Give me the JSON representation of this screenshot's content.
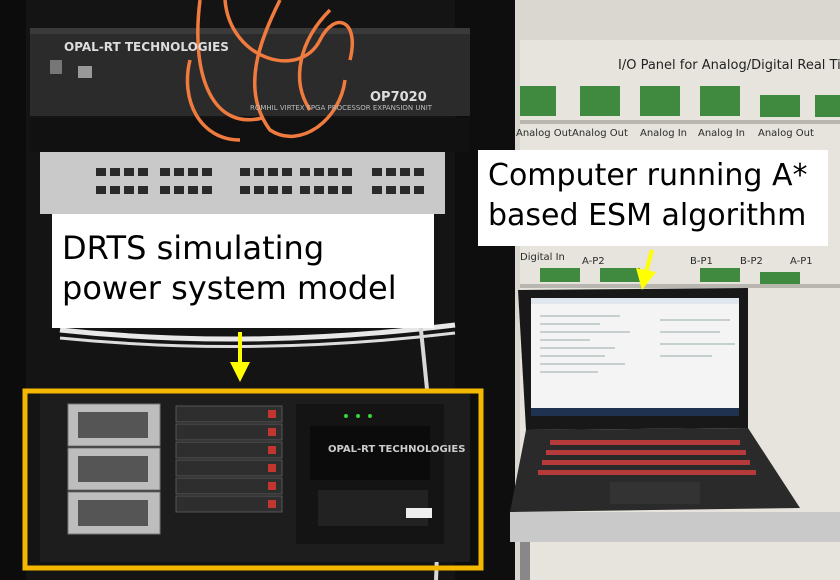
{
  "annotations": {
    "drts_label": [
      "DRTS simulating",
      "power system model"
    ],
    "computer_label": [
      "Computer running A*",
      "based ESM algorithm"
    ]
  },
  "equipment": {
    "expansion_unit_brand": "OPAL-RT TECHNOLOGIES",
    "expansion_unit_model": "OP7020",
    "expansion_unit_subtitle": "ROMHIL VIRTEX FPGA PROCESSOR EXPANSION UNIT",
    "simulator_brand": "OPAL-RT TECHNOLOGIES"
  },
  "io_panel": {
    "title": "I/O Panel for Analog/Digital Real Time Si",
    "row1_labels": [
      "Analog Out",
      "Analog Out",
      "Analog In",
      "Analog In",
      "Analog Out"
    ],
    "row2_labels": [
      "Digital In",
      "A-P2",
      "B-P1",
      "B-P2",
      "A-P1"
    ]
  },
  "colors": {
    "highlight_box": "#f5b800",
    "arrow": "#ffff00",
    "cable": "#f07b3f"
  }
}
